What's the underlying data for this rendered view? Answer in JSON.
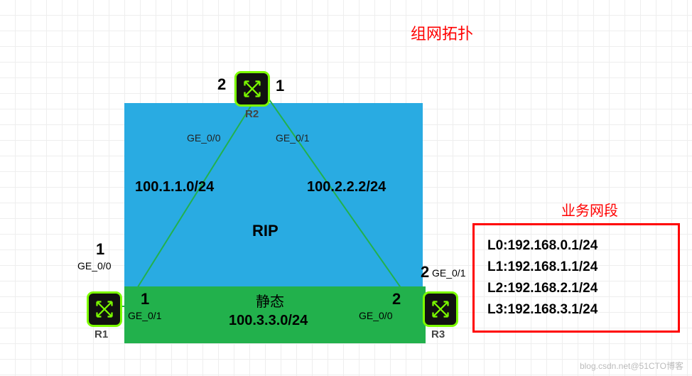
{
  "title": "组网拓扑",
  "routers": {
    "r1": {
      "name": "R1"
    },
    "r2": {
      "name": "R2"
    },
    "r3": {
      "name": "R3"
    }
  },
  "port_numbers": {
    "r2_left": "2",
    "r2_right": "1",
    "r1_top": "1",
    "r1_bottom": "1",
    "r3_top": "2",
    "r3_bottom": "2"
  },
  "interfaces": {
    "r2_ge00": "GE_0/0",
    "r2_ge01": "GE_0/1",
    "r1_ge00": "GE_0/0",
    "r1_ge01": "GE_0/1",
    "r3_ge00": "GE_0/0",
    "r3_ge01": "GE_0/1"
  },
  "networks": {
    "left": "100.1.1.0/24",
    "right": "100.2.2.2/24",
    "bottom": "100.3.3.0/24"
  },
  "protocols": {
    "rip": "RIP",
    "static_cn": "静态"
  },
  "legend": {
    "title": "业务网段",
    "items": [
      "L0:192.168.0.1/24",
      "L1:192.168.1.1/24",
      "L2:192.168.2.1/24",
      "L3:192.168.3.1/24"
    ]
  },
  "watermark": "blog.csdn.net@51CTO博客",
  "chart_data": {
    "type": "table",
    "description": "Network topology: three routers R1, R2, R3 forming a triangle. R1↔R2 and R2↔R3 links run RIP (blue area). R1↔R3 bottom link uses static routing (green area). Business loopback subnets listed in legend.",
    "nodes": [
      {
        "id": "R1"
      },
      {
        "id": "R2"
      },
      {
        "id": "R3"
      }
    ],
    "links": [
      {
        "from": "R2",
        "from_if": "GE_0/0",
        "from_portnum": 2,
        "to": "R1",
        "to_if": "GE_0/0",
        "to_portnum": 1,
        "network": "100.1.1.0/24",
        "protocol": "RIP"
      },
      {
        "from": "R2",
        "from_if": "GE_0/1",
        "from_portnum": 1,
        "to": "R3",
        "to_if": "GE_0/1",
        "to_portnum": 2,
        "network": "100.2.2.2/24",
        "protocol": "RIP"
      },
      {
        "from": "R1",
        "from_if": "GE_0/1",
        "from_portnum": 1,
        "to": "R3",
        "to_if": "GE_0/0",
        "to_portnum": 2,
        "network": "100.3.3.0/24",
        "protocol": "static"
      }
    ],
    "business_subnets": [
      {
        "name": "L0",
        "cidr": "192.168.0.1/24"
      },
      {
        "name": "L1",
        "cidr": "192.168.1.1/24"
      },
      {
        "name": "L2",
        "cidr": "192.168.2.1/24"
      },
      {
        "name": "L3",
        "cidr": "192.168.3.1/24"
      }
    ]
  }
}
